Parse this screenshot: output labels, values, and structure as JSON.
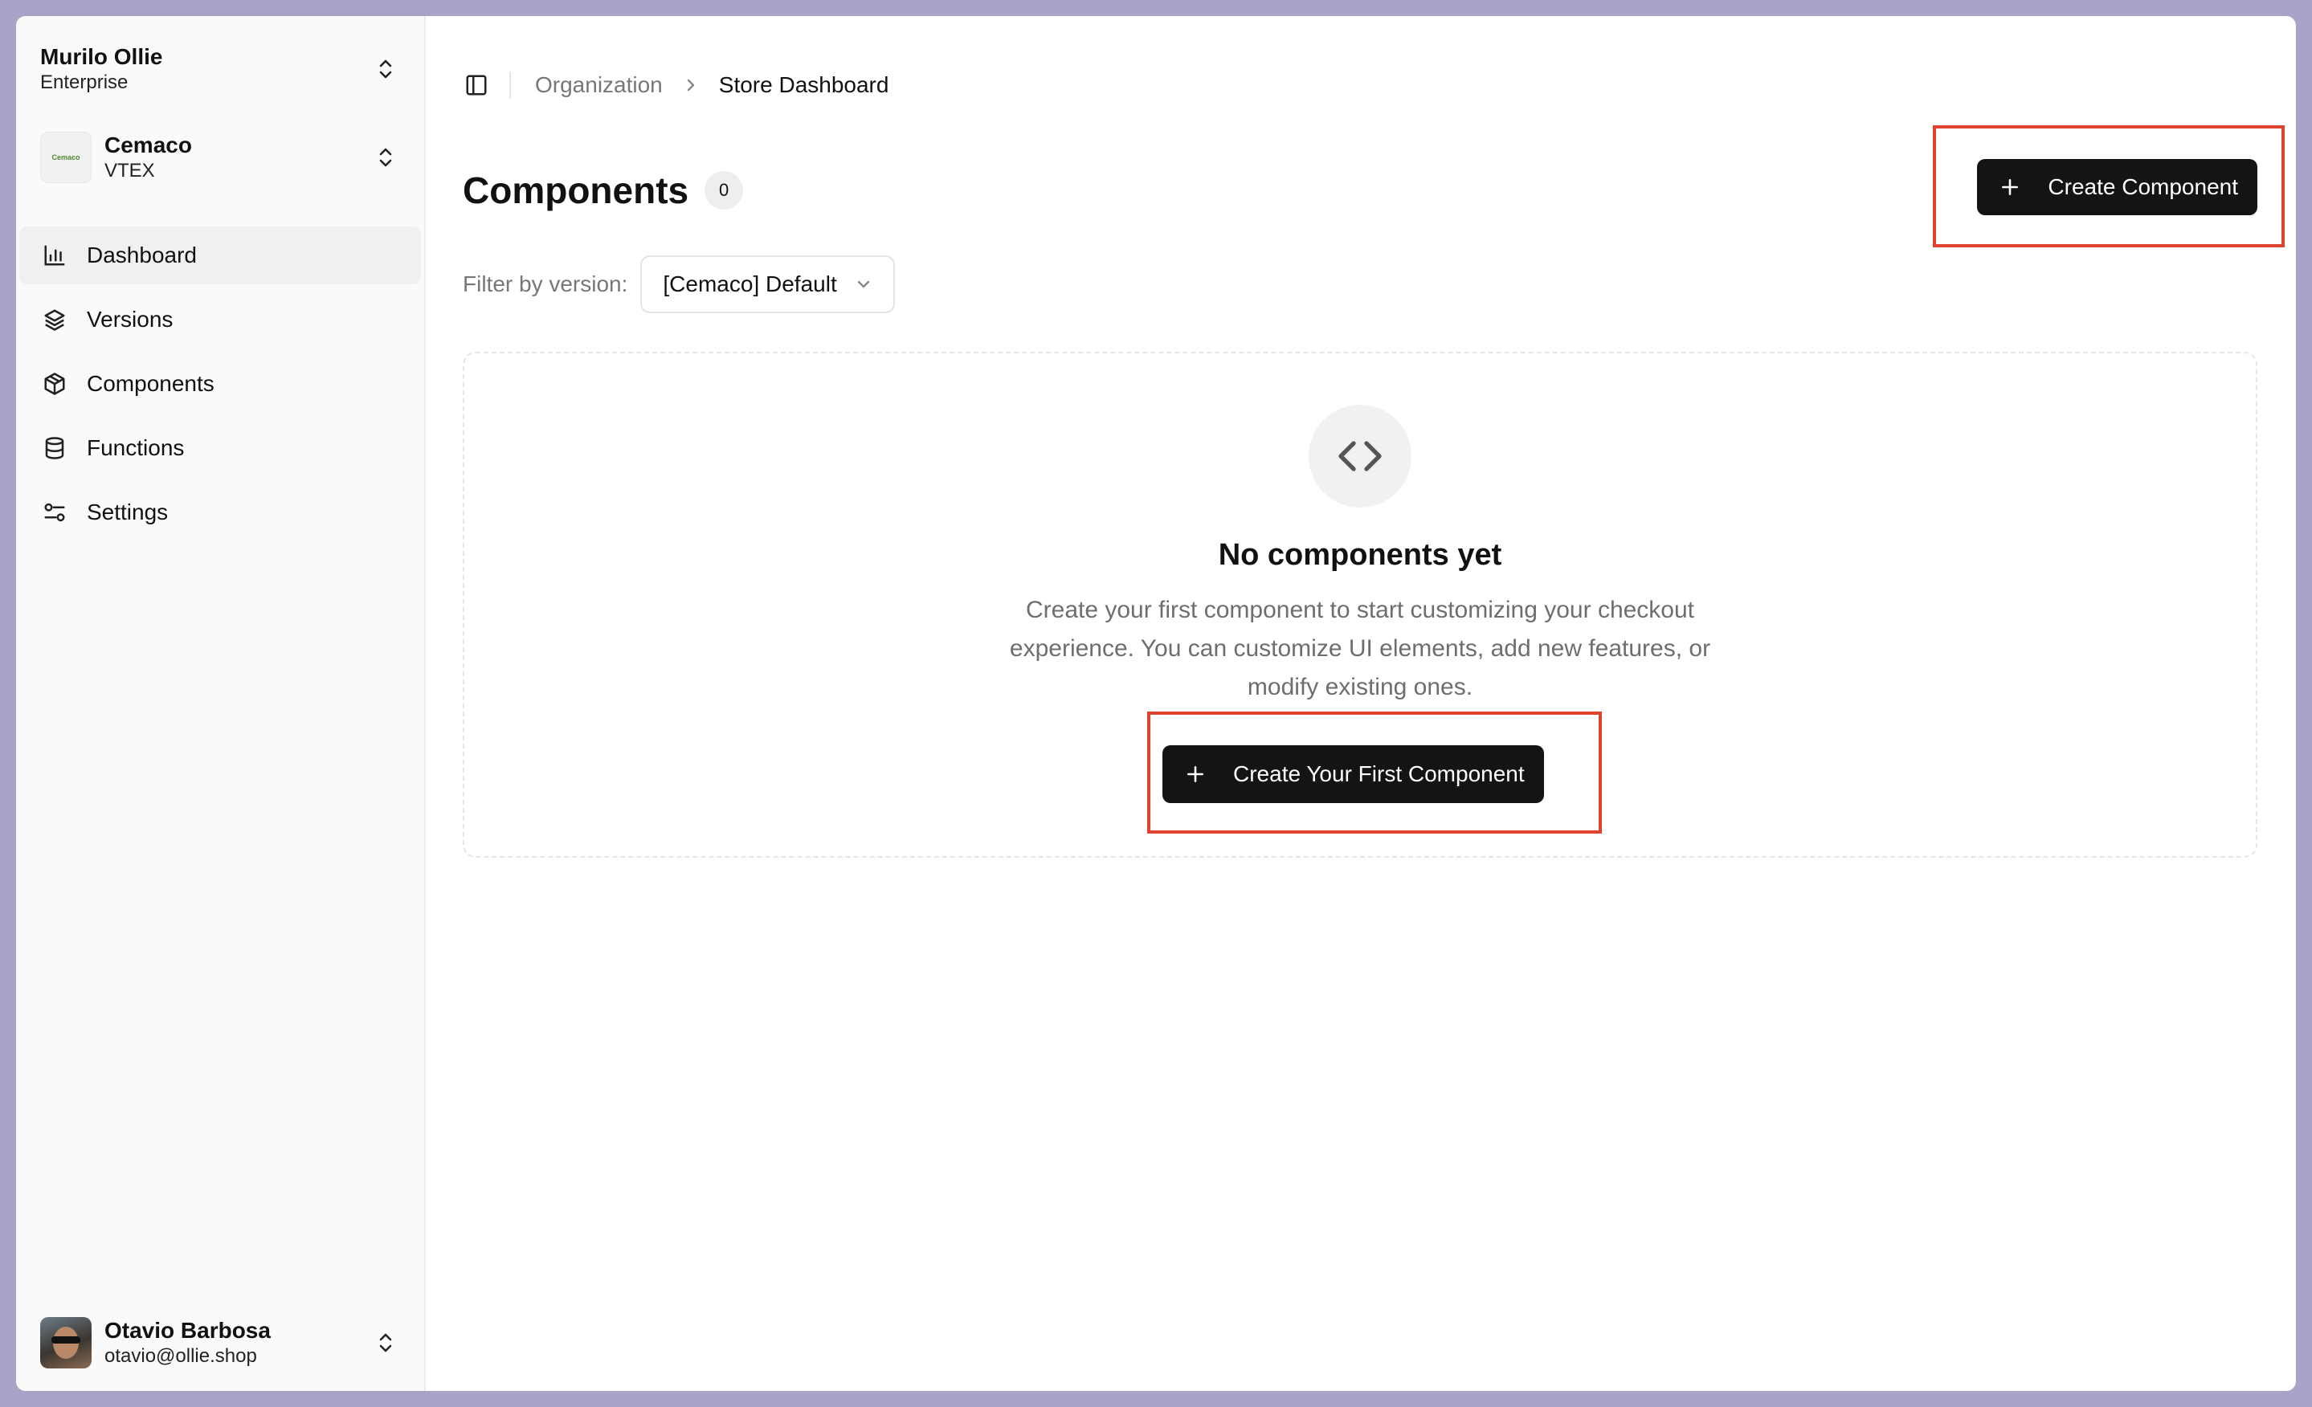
{
  "org": {
    "name": "Murilo Ollie",
    "plan": "Enterprise"
  },
  "store": {
    "name": "Cemaco",
    "platform": "VTEX",
    "logo_text": "Cemaco"
  },
  "nav": {
    "items": [
      {
        "label": "Dashboard",
        "icon": "bar-chart-icon",
        "active": true
      },
      {
        "label": "Versions",
        "icon": "layers-icon"
      },
      {
        "label": "Components",
        "icon": "box-icon"
      },
      {
        "label": "Functions",
        "icon": "database-icon"
      },
      {
        "label": "Settings",
        "icon": "sliders-icon"
      }
    ]
  },
  "user": {
    "name": "Otavio Barbosa",
    "email": "otavio@ollie.shop"
  },
  "breadcrumb": {
    "parent": "Organization",
    "current": "Store Dashboard"
  },
  "page": {
    "title": "Components",
    "count": "0",
    "create_label": "Create Component"
  },
  "filter": {
    "label": "Filter by version:",
    "selected": "[Cemaco] Default"
  },
  "empty_state": {
    "icon": "code-icon",
    "title": "No components yet",
    "description": "Create your first component to start customizing your checkout experience. You can customize UI elements, add new features, or modify existing ones.",
    "button_label": "Create Your First Component"
  },
  "colors": {
    "highlight": "#e0432f",
    "primary_button": "#141414"
  }
}
